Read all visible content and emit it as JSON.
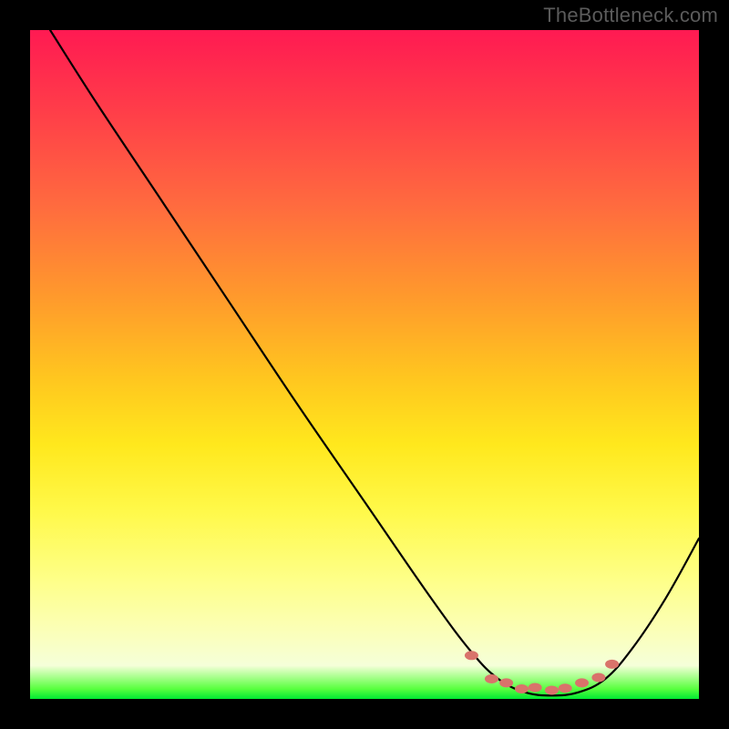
{
  "watermark": "TheBottleneck.com",
  "chart_data": {
    "type": "line",
    "title": "",
    "xlabel": "",
    "ylabel": "",
    "xlim": [
      0,
      100
    ],
    "ylim": [
      0,
      100
    ],
    "grid": false,
    "series": [
      {
        "name": "bottleneck-curve",
        "color": "#000000",
        "x": [
          3,
          10,
          20,
          30,
          40,
          50,
          60,
          66,
          70,
          74,
          78,
          82,
          86,
          90,
          95,
          100
        ],
        "y": [
          100,
          89,
          74,
          59,
          44,
          29.5,
          15,
          7,
          3,
          1,
          0.5,
          1,
          3,
          7.5,
          15,
          24
        ]
      }
    ],
    "markers": {
      "name": "optimal-zone-dots",
      "color": "#d9736b",
      "points": [
        {
          "x": 66,
          "y": 6.5
        },
        {
          "x": 69,
          "y": 3
        },
        {
          "x": 71.2,
          "y": 2.4
        },
        {
          "x": 73.5,
          "y": 1.5
        },
        {
          "x": 75.5,
          "y": 1.7
        },
        {
          "x": 78,
          "y": 1.3
        },
        {
          "x": 80,
          "y": 1.6
        },
        {
          "x": 82.5,
          "y": 2.4
        },
        {
          "x": 85,
          "y": 3.2
        },
        {
          "x": 87,
          "y": 5.2
        }
      ]
    },
    "gradient_scale": {
      "top_color": "#ff1a52",
      "mid_color": "#ffe81d",
      "bottom_color": "#00e833"
    }
  }
}
